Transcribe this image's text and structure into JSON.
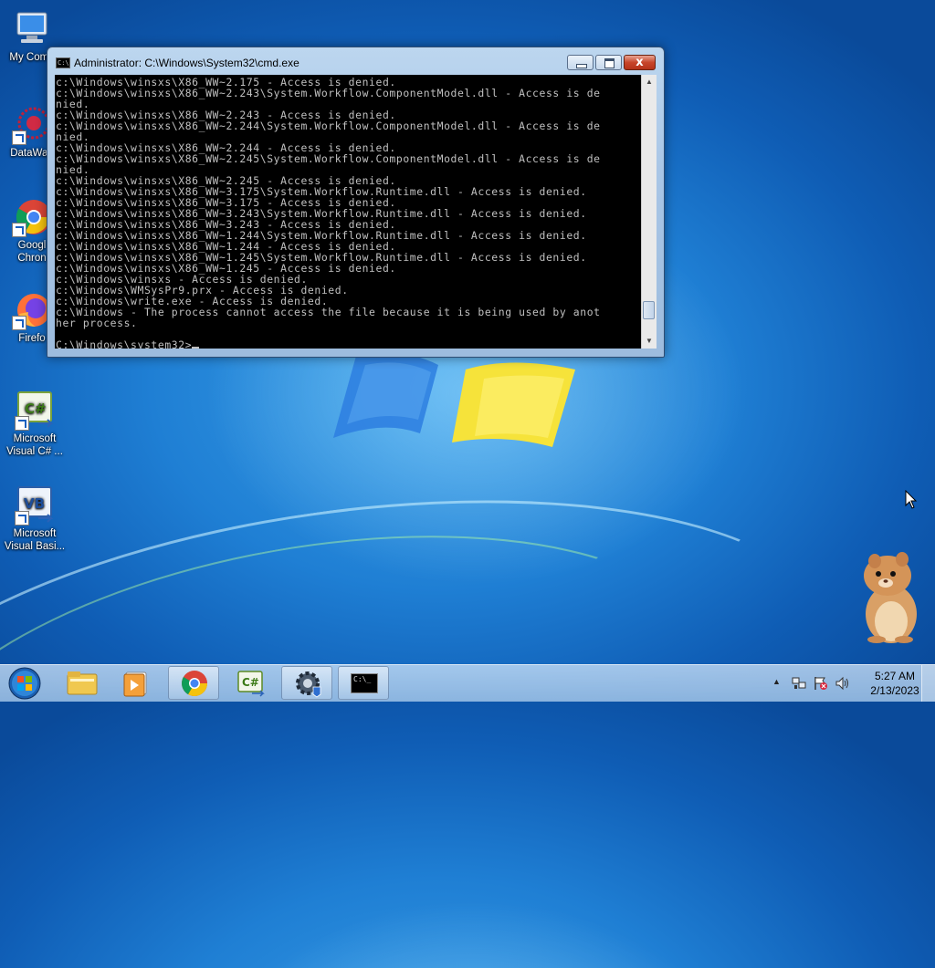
{
  "desktop": {
    "icons": [
      {
        "label": "My Comp",
        "icon": "computer-icon"
      },
      {
        "label": "DataWag",
        "icon": "datawag-icon"
      },
      {
        "label": "Googl",
        "label2": "Chron",
        "icon": "chrome-icon"
      },
      {
        "label": "Firefo",
        "icon": "firefox-icon"
      },
      {
        "label": "Microsoft",
        "label2": "Visual C# ...",
        "icon": "visual-csharp-icon"
      },
      {
        "label": "Microsoft",
        "label2": "Visual Basi...",
        "icon": "visual-basic-icon"
      }
    ],
    "gadget_icon": "hamster-gadget-icon"
  },
  "cmd_window": {
    "title": "Administrator: C:\\Windows\\System32\\cmd.exe",
    "close_glyph": "x",
    "lines": [
      "c:\\Windows\\winsxs\\X86_WW~2.175 - Access is denied.",
      "c:\\Windows\\winsxs\\X86_WW~2.243\\System.Workflow.ComponentModel.dll - Access is de",
      "nied.",
      "c:\\Windows\\winsxs\\X86_WW~2.243 - Access is denied.",
      "c:\\Windows\\winsxs\\X86_WW~2.244\\System.Workflow.ComponentModel.dll - Access is de",
      "nied.",
      "c:\\Windows\\winsxs\\X86_WW~2.244 - Access is denied.",
      "c:\\Windows\\winsxs\\X86_WW~2.245\\System.Workflow.ComponentModel.dll - Access is de",
      "nied.",
      "c:\\Windows\\winsxs\\X86_WW~2.245 - Access is denied.",
      "c:\\Windows\\winsxs\\X86_WW~3.175\\System.Workflow.Runtime.dll - Access is denied.",
      "c:\\Windows\\winsxs\\X86_WW~3.175 - Access is denied.",
      "c:\\Windows\\winsxs\\X86_WW~3.243\\System.Workflow.Runtime.dll - Access is denied.",
      "c:\\Windows\\winsxs\\X86_WW~3.243 - Access is denied.",
      "c:\\Windows\\winsxs\\X86_WW~1.244\\System.Workflow.Runtime.dll - Access is denied.",
      "c:\\Windows\\winsxs\\X86_WW~1.244 - Access is denied.",
      "c:\\Windows\\winsxs\\X86_WW~1.245\\System.Workflow.Runtime.dll - Access is denied.",
      "c:\\Windows\\winsxs\\X86_WW~1.245 - Access is denied.",
      "c:\\Windows\\winsxs - Access is denied.",
      "c:\\Windows\\WMSysPr9.prx - Access is denied.",
      "c:\\Windows\\write.exe - Access is denied.",
      "c:\\Windows - The process cannot access the file because it is being used by anot",
      "her process.",
      "",
      "C:\\Windows\\system32>"
    ],
    "scroll_position": 0.92
  },
  "taskbar": {
    "items": [
      {
        "icon": "start-orb-icon"
      },
      {
        "icon": "windows-explorer-icon"
      },
      {
        "icon": "media-player-icon"
      },
      {
        "icon": "chrome-icon"
      },
      {
        "icon": "visual-csharp-icon"
      },
      {
        "icon": "settings-gear-icon"
      },
      {
        "icon": "cmd-icon",
        "active": true
      }
    ],
    "tray_icons": [
      "show-hidden-icons-arrow",
      "network-icon",
      "action-center-flag-icon",
      "volume-icon"
    ],
    "clock_time": "5:27 AM",
    "clock_date": "2/13/2023",
    "cmd_badge": "C:\\_"
  }
}
